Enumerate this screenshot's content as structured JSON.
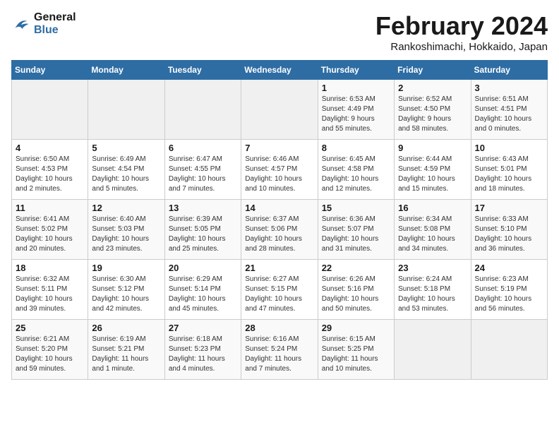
{
  "header": {
    "logo_line1": "General",
    "logo_line2": "Blue",
    "month_year": "February 2024",
    "location": "Rankoshimachi, Hokkaido, Japan"
  },
  "weekdays": [
    "Sunday",
    "Monday",
    "Tuesday",
    "Wednesday",
    "Thursday",
    "Friday",
    "Saturday"
  ],
  "weeks": [
    [
      {
        "day": "",
        "info": ""
      },
      {
        "day": "",
        "info": ""
      },
      {
        "day": "",
        "info": ""
      },
      {
        "day": "",
        "info": ""
      },
      {
        "day": "1",
        "info": "Sunrise: 6:53 AM\nSunset: 4:49 PM\nDaylight: 9 hours\nand 55 minutes."
      },
      {
        "day": "2",
        "info": "Sunrise: 6:52 AM\nSunset: 4:50 PM\nDaylight: 9 hours\nand 58 minutes."
      },
      {
        "day": "3",
        "info": "Sunrise: 6:51 AM\nSunset: 4:51 PM\nDaylight: 10 hours\nand 0 minutes."
      }
    ],
    [
      {
        "day": "4",
        "info": "Sunrise: 6:50 AM\nSunset: 4:53 PM\nDaylight: 10 hours\nand 2 minutes."
      },
      {
        "day": "5",
        "info": "Sunrise: 6:49 AM\nSunset: 4:54 PM\nDaylight: 10 hours\nand 5 minutes."
      },
      {
        "day": "6",
        "info": "Sunrise: 6:47 AM\nSunset: 4:55 PM\nDaylight: 10 hours\nand 7 minutes."
      },
      {
        "day": "7",
        "info": "Sunrise: 6:46 AM\nSunset: 4:57 PM\nDaylight: 10 hours\nand 10 minutes."
      },
      {
        "day": "8",
        "info": "Sunrise: 6:45 AM\nSunset: 4:58 PM\nDaylight: 10 hours\nand 12 minutes."
      },
      {
        "day": "9",
        "info": "Sunrise: 6:44 AM\nSunset: 4:59 PM\nDaylight: 10 hours\nand 15 minutes."
      },
      {
        "day": "10",
        "info": "Sunrise: 6:43 AM\nSunset: 5:01 PM\nDaylight: 10 hours\nand 18 minutes."
      }
    ],
    [
      {
        "day": "11",
        "info": "Sunrise: 6:41 AM\nSunset: 5:02 PM\nDaylight: 10 hours\nand 20 minutes."
      },
      {
        "day": "12",
        "info": "Sunrise: 6:40 AM\nSunset: 5:03 PM\nDaylight: 10 hours\nand 23 minutes."
      },
      {
        "day": "13",
        "info": "Sunrise: 6:39 AM\nSunset: 5:05 PM\nDaylight: 10 hours\nand 25 minutes."
      },
      {
        "day": "14",
        "info": "Sunrise: 6:37 AM\nSunset: 5:06 PM\nDaylight: 10 hours\nand 28 minutes."
      },
      {
        "day": "15",
        "info": "Sunrise: 6:36 AM\nSunset: 5:07 PM\nDaylight: 10 hours\nand 31 minutes."
      },
      {
        "day": "16",
        "info": "Sunrise: 6:34 AM\nSunset: 5:08 PM\nDaylight: 10 hours\nand 34 minutes."
      },
      {
        "day": "17",
        "info": "Sunrise: 6:33 AM\nSunset: 5:10 PM\nDaylight: 10 hours\nand 36 minutes."
      }
    ],
    [
      {
        "day": "18",
        "info": "Sunrise: 6:32 AM\nSunset: 5:11 PM\nDaylight: 10 hours\nand 39 minutes."
      },
      {
        "day": "19",
        "info": "Sunrise: 6:30 AM\nSunset: 5:12 PM\nDaylight: 10 hours\nand 42 minutes."
      },
      {
        "day": "20",
        "info": "Sunrise: 6:29 AM\nSunset: 5:14 PM\nDaylight: 10 hours\nand 45 minutes."
      },
      {
        "day": "21",
        "info": "Sunrise: 6:27 AM\nSunset: 5:15 PM\nDaylight: 10 hours\nand 47 minutes."
      },
      {
        "day": "22",
        "info": "Sunrise: 6:26 AM\nSunset: 5:16 PM\nDaylight: 10 hours\nand 50 minutes."
      },
      {
        "day": "23",
        "info": "Sunrise: 6:24 AM\nSunset: 5:18 PM\nDaylight: 10 hours\nand 53 minutes."
      },
      {
        "day": "24",
        "info": "Sunrise: 6:23 AM\nSunset: 5:19 PM\nDaylight: 10 hours\nand 56 minutes."
      }
    ],
    [
      {
        "day": "25",
        "info": "Sunrise: 6:21 AM\nSunset: 5:20 PM\nDaylight: 10 hours\nand 59 minutes."
      },
      {
        "day": "26",
        "info": "Sunrise: 6:19 AM\nSunset: 5:21 PM\nDaylight: 11 hours\nand 1 minute."
      },
      {
        "day": "27",
        "info": "Sunrise: 6:18 AM\nSunset: 5:23 PM\nDaylight: 11 hours\nand 4 minutes."
      },
      {
        "day": "28",
        "info": "Sunrise: 6:16 AM\nSunset: 5:24 PM\nDaylight: 11 hours\nand 7 minutes."
      },
      {
        "day": "29",
        "info": "Sunrise: 6:15 AM\nSunset: 5:25 PM\nDaylight: 11 hours\nand 10 minutes."
      },
      {
        "day": "",
        "info": ""
      },
      {
        "day": "",
        "info": ""
      }
    ]
  ]
}
